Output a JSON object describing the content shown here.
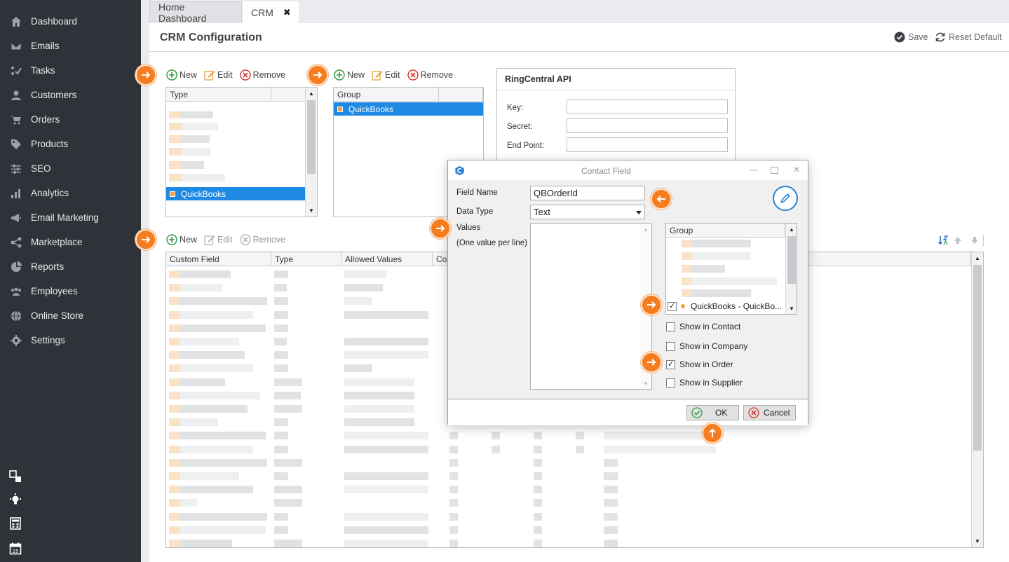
{
  "sidebar": {
    "items": [
      {
        "label": "Dashboard",
        "icon": "home-icon"
      },
      {
        "label": "Emails",
        "icon": "envelope-icon"
      },
      {
        "label": "Tasks",
        "icon": "tasks-icon"
      },
      {
        "label": "Customers",
        "icon": "user-icon"
      },
      {
        "label": "Orders",
        "icon": "cart-icon"
      },
      {
        "label": "Products",
        "icon": "tag-icon"
      },
      {
        "label": "SEO",
        "icon": "sliders-icon"
      },
      {
        "label": "Analytics",
        "icon": "bar-chart-icon"
      },
      {
        "label": "Email Marketing",
        "icon": "megaphone-icon"
      },
      {
        "label": "Marketplace",
        "icon": "share-icon"
      },
      {
        "label": "Reports",
        "icon": "pie-chart-icon"
      },
      {
        "label": "Employees",
        "icon": "users-icon"
      },
      {
        "label": "Online Store",
        "icon": "globe-icon"
      },
      {
        "label": "Settings",
        "icon": "gear-icon"
      }
    ],
    "tools": [
      "widgets-icon",
      "lightbulb-icon",
      "calculator-icon",
      "calendar-icon"
    ],
    "calendar_day": "25"
  },
  "tabs": [
    {
      "label": "Home Dashboard",
      "active": false
    },
    {
      "label": "CRM",
      "active": true,
      "close": "✖"
    }
  ],
  "page": {
    "title": "CRM Configuration",
    "save_label": "Save",
    "reset_label": "Reset Default"
  },
  "toolbar": {
    "new_label": "New",
    "edit_label": "Edit",
    "remove_label": "Remove"
  },
  "type_grid": {
    "header": "Type",
    "selected": "QuickBooks"
  },
  "group_grid": {
    "header": "Group",
    "selected": "QuickBooks"
  },
  "fields_grid": {
    "columns": [
      "Custom Field",
      "Type",
      "Allowed Values",
      "Co"
    ]
  },
  "ringcentral": {
    "title": "RingCentral API",
    "key_label": "Key:",
    "secret_label": "Secret:",
    "endpoint_label": "End Point:"
  },
  "dialog": {
    "title": "Contact Field",
    "field_name_label": "Field Name",
    "field_name_value": "QBOrderId",
    "data_type_label": "Data Type",
    "data_type_value": "Text",
    "values_label": "Values",
    "values_hint": "(One value per line)",
    "group_header": "Group",
    "group_checked_item": "QuickBooks - QuickBo...",
    "checks": [
      {
        "label": "Show in Contact",
        "checked": false
      },
      {
        "label": "Show in Company",
        "checked": false
      },
      {
        "label": "Show in Order",
        "checked": true
      },
      {
        "label": "Show in Supplier",
        "checked": false
      }
    ],
    "check_mark": "✓",
    "ok_label": "OK",
    "cancel_label": "Cancel"
  },
  "colors": {
    "sidebar_bg": "#2f3339",
    "accent_blue": "#1f8ae3",
    "callout_orange": "#f57c1f"
  }
}
